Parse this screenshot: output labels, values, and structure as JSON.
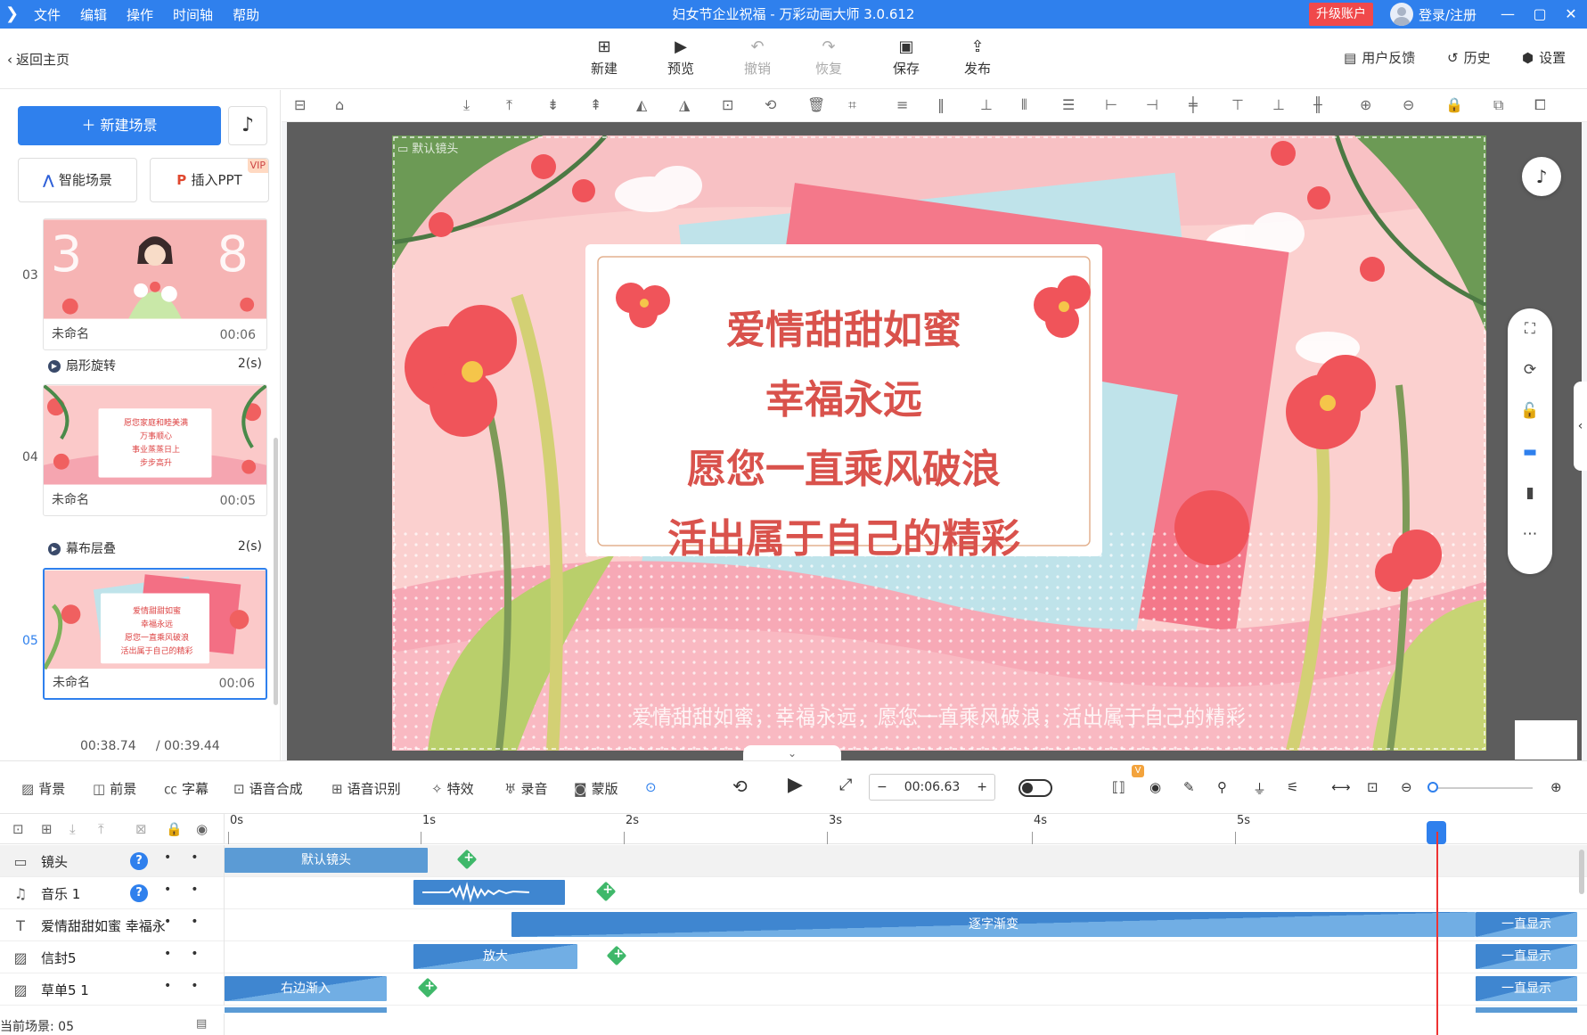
{
  "titlebar": {
    "menu": [
      "文件",
      "编辑",
      "操作",
      "时间轴",
      "帮助"
    ],
    "title": "妇女节企业祝福 - 万彩动画大师 3.0.612",
    "upgrade": "升级账户",
    "login": "登录/注册"
  },
  "toolbar": {
    "back": "返回主页",
    "new": "新建",
    "preview": "预览",
    "undo": "撤销",
    "redo": "恢复",
    "save": "保存",
    "publish": "发布",
    "feedback": "用户反馈",
    "history": "历史",
    "settings": "设置"
  },
  "left": {
    "new_scene": "新建场景",
    "smart_scene": "智能场景",
    "insert_ppt": "插入PPT",
    "vip": "VIP",
    "scenes": [
      {
        "num": "03",
        "name": "未命名",
        "dur": "00:06"
      },
      {
        "num": "04",
        "name": "未命名",
        "dur": "00:05"
      },
      {
        "num": "05",
        "name": "未命名",
        "dur": "00:06"
      }
    ],
    "transitions": [
      {
        "name": "扇形旋转",
        "dur": "2(s)"
      },
      {
        "name": "幕布层叠",
        "dur": "2(s)"
      }
    ],
    "thumb04_lines": [
      "愿您家庭和睦美满",
      "万事顺心",
      "事业蒸蒸日上",
      "步步高升"
    ],
    "thumb05_lines": [
      "爱情甜甜如蜜",
      "幸福永远",
      "愿您一直乘风破浪",
      "活出属于自己的精彩"
    ],
    "time_current": "00:38.74",
    "time_total": "/ 00:39.44"
  },
  "stage": {
    "camera_label": "默认镜头",
    "lines": [
      "爱情甜甜如蜜",
      "幸福永远",
      "愿您一直乘风破浪",
      "活出属于自己的精彩"
    ],
    "subtitle": "爱情甜甜如蜜，幸福永远，愿您一直乘风破浪，活出属于自己的精彩"
  },
  "bottombar": {
    "background": "背景",
    "foreground": "前景",
    "caption": "字幕",
    "tts": "语音合成",
    "asr": "语音识别",
    "effects": "特效",
    "record": "录音",
    "mask": "蒙版",
    "time": "00:06.63"
  },
  "timeline": {
    "ruler": [
      "0s",
      "1s",
      "2s",
      "3s",
      "4s",
      "5s"
    ],
    "rows": [
      {
        "label": "镜头",
        "clips": [
          "默认镜头"
        ]
      },
      {
        "label": "音乐 1",
        "clips": []
      },
      {
        "label": "爱情甜甜如蜜 幸福永",
        "clips": [
          "逐字渐变",
          "一直显示"
        ]
      },
      {
        "label": "信封5",
        "clips": [
          "放大",
          "一直显示"
        ]
      },
      {
        "label": "草单5 1",
        "clips": [
          "右边渐入",
          "一直显示"
        ]
      }
    ],
    "status": "当前场景: 05"
  },
  "colors": {
    "accent": "#2f80ed",
    "upgrade": "#f0494b",
    "keyframe": "#3fb86a",
    "playhead": "#ee3333"
  }
}
